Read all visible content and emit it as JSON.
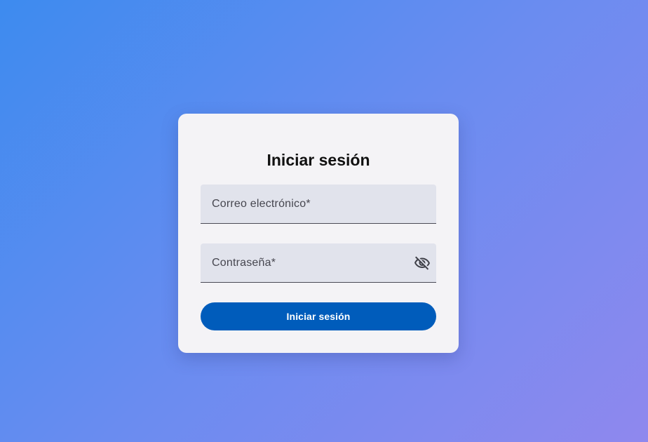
{
  "login": {
    "title": "Iniciar sesión",
    "email": {
      "label": "Correo electrónico*",
      "value": ""
    },
    "password": {
      "label": "Contraseña*",
      "value": "",
      "toggle_icon": "visibility-off-icon"
    },
    "submit_label": "Iniciar sesión"
  },
  "colors": {
    "primary": "#005cbb",
    "card_background": "#f4f3f6",
    "field_background": "#e1e3ec",
    "gradient_start": "#3d8bef",
    "gradient_end": "#8f88ee"
  }
}
